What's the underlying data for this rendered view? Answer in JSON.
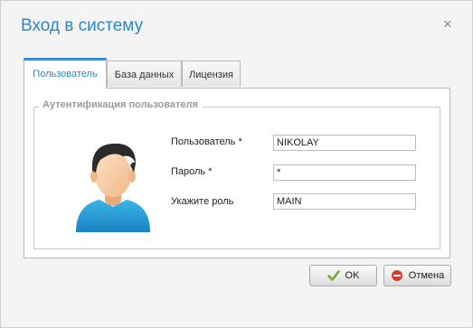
{
  "dialog": {
    "title": "Вход в систему",
    "close_glyph": "×"
  },
  "tabs": [
    {
      "label": "Пользователь",
      "active": true
    },
    {
      "label": "База данных",
      "active": false
    },
    {
      "label": "Лицензия",
      "active": false
    }
  ],
  "auth_group": {
    "legend": "Аутентификация пользователя",
    "avatar_icon": "user-avatar-icon",
    "fields": [
      {
        "label": "Пользователь *",
        "value": "NIKOLAY"
      },
      {
        "label": "Пароль *",
        "value": "*"
      },
      {
        "label": "Укажите роль",
        "value": "MAIN"
      }
    ]
  },
  "buttons": {
    "ok_label": "OK",
    "ok_icon": "checkmark-icon",
    "cancel_label": "Отмена",
    "cancel_icon": "cancel-icon"
  },
  "colors": {
    "accent": "#2e86c8",
    "ok_green": "#6ab234",
    "cancel_red": "#d33b2c"
  }
}
